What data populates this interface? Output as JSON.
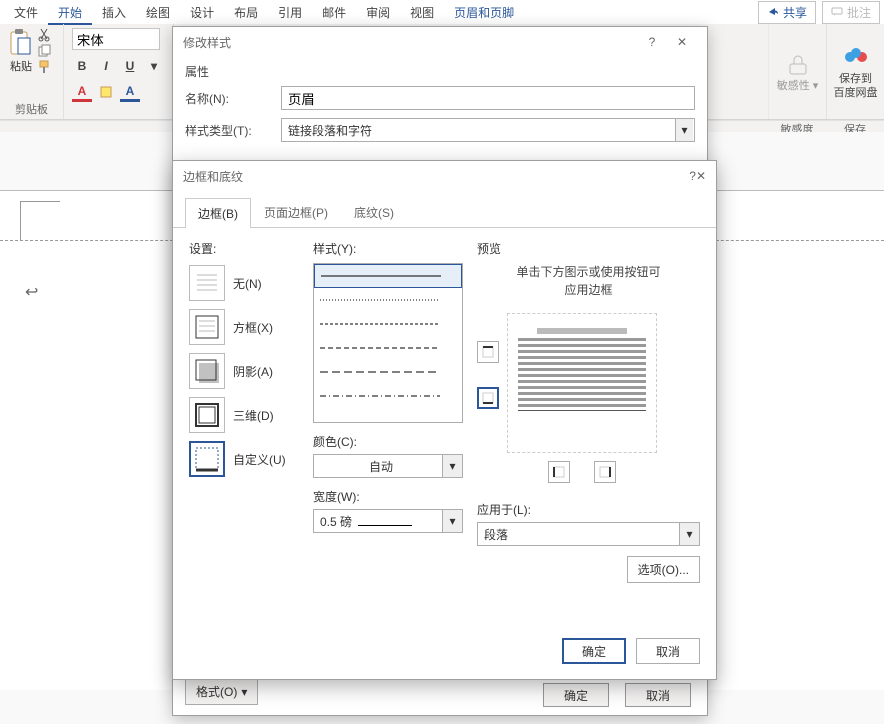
{
  "ribbon": {
    "tabs": [
      "文件",
      "开始",
      "插入",
      "绘图",
      "设计",
      "布局",
      "引用",
      "邮件",
      "审阅",
      "视图",
      "页眉和页脚"
    ],
    "active_index": 1,
    "share": "共享",
    "comments": "批注"
  },
  "toolbar": {
    "font_name": "宋体",
    "paste_label": "粘贴",
    "clipboard_group": "剪贴板",
    "sensitivity": "敏感性",
    "sensitivity_group": "敏感度",
    "save_to": "保存到",
    "save_cloud": "百度网盘",
    "save_group": "保存"
  },
  "dialog1": {
    "title": "修改样式",
    "props": "属性",
    "name_label": "名称(N):",
    "name_value": "页眉",
    "type_label": "样式类型(T):",
    "type_value": "链接段落和字符",
    "format_btn": "格式(O)",
    "ok": "确定",
    "cancel": "取消"
  },
  "dialog2": {
    "title": "边框和底纹",
    "tabs": [
      "边框(B)",
      "页面边框(P)",
      "底纹(S)"
    ],
    "set_label": "设置:",
    "presets": [
      {
        "label": "无(N)"
      },
      {
        "label": "方框(X)"
      },
      {
        "label": "阴影(A)"
      },
      {
        "label": "三维(D)"
      },
      {
        "label": "自定义(U)"
      }
    ],
    "style_label": "样式(Y):",
    "color_label": "颜色(C):",
    "color_value": "自动",
    "width_label": "宽度(W):",
    "width_value": "0.5 磅",
    "preview_label": "预览",
    "preview_hint1": "单击下方图示或使用按钮可",
    "preview_hint2": "应用边框",
    "apply_label": "应用于(L):",
    "apply_value": "段落",
    "options_btn": "选项(O)...",
    "ok": "确定",
    "cancel": "取消"
  }
}
